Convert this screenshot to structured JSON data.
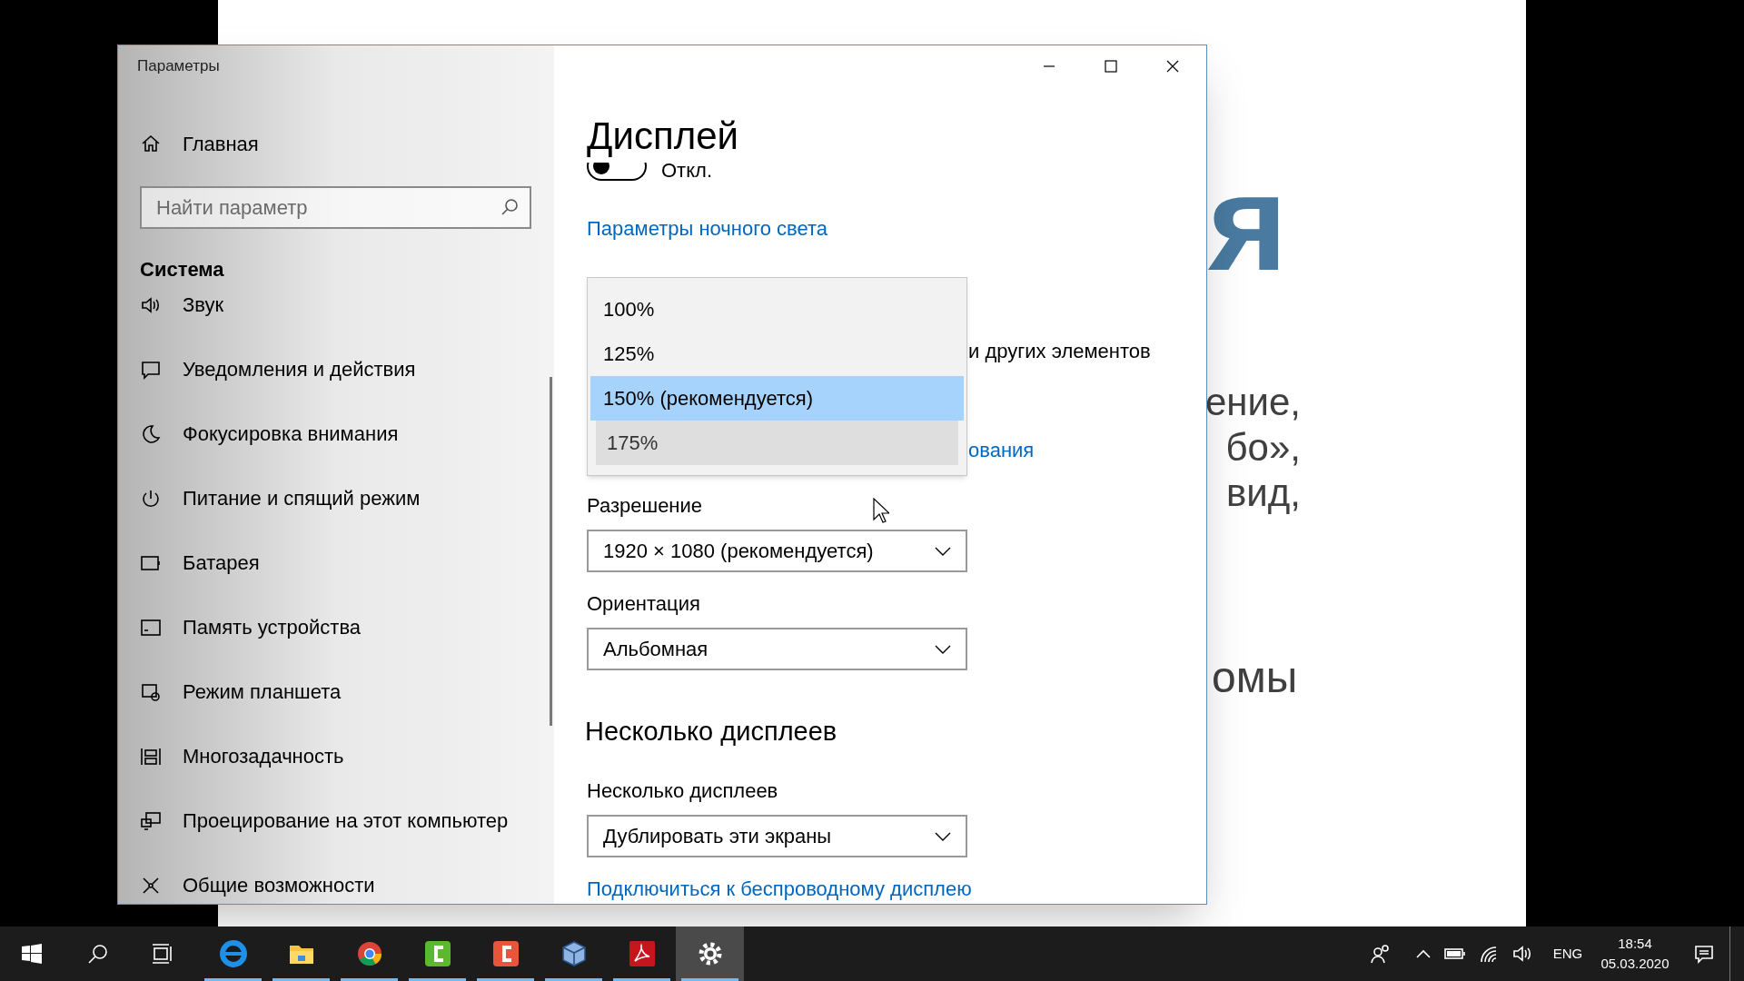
{
  "window": {
    "title": "Параметры"
  },
  "sidebar": {
    "home": "Главная",
    "search": {
      "placeholder": "Найти параметр"
    },
    "section": "Система",
    "items": [
      {
        "label": "Звук",
        "kind": "sound"
      },
      {
        "label": "Уведомления и действия",
        "kind": "notifications"
      },
      {
        "label": "Фокусировка внимания",
        "kind": "focus"
      },
      {
        "label": "Питание и спящий режим",
        "kind": "power"
      },
      {
        "label": "Батарея",
        "kind": "battery"
      },
      {
        "label": "Память устройства",
        "kind": "storage"
      },
      {
        "label": "Режим планшета",
        "kind": "tablet"
      },
      {
        "label": "Многозадачность",
        "kind": "multitasking"
      },
      {
        "label": "Проецирование на этот компьютер",
        "kind": "projecting"
      },
      {
        "label": "Общие возможности",
        "kind": "shared"
      }
    ]
  },
  "content": {
    "title": "Дисплей",
    "toggle": {
      "on": false,
      "label": "Откл."
    },
    "night_light_link": "Параметры ночного света",
    "scale_text_fragment": "и других элементов",
    "scale_link_fragment": "ования",
    "scale_dropdown": {
      "options": [
        {
          "label": "100%",
          "selected": false,
          "hovered": false
        },
        {
          "label": "125%",
          "selected": false,
          "hovered": false
        },
        {
          "label": "150% (рекомендуется)",
          "selected": true,
          "hovered": false
        },
        {
          "label": "175%",
          "selected": false,
          "hovered": true
        }
      ]
    },
    "resolution": {
      "label": "Разрешение",
      "value": "1920 × 1080 (рекомендуется)"
    },
    "orientation": {
      "label": "Ориентация",
      "value": "Альбомная"
    },
    "multiple_displays": {
      "heading": "Несколько дисплеев",
      "label": "Несколько дисплеев",
      "value": "Дублировать эти экраны"
    },
    "wireless_link": "Подключиться к беспроводному дисплею"
  },
  "background_slide": {
    "title_fragment": "я",
    "lines": [
      "ение,",
      "бо»,",
      "вид,"
    ],
    "line_fragment": "омы"
  },
  "taskbar": {
    "apps": [
      {
        "kind": "browser",
        "running": true,
        "selected": false
      },
      {
        "kind": "folder",
        "running": true,
        "selected": false
      },
      {
        "kind": "chrome",
        "running": true,
        "selected": false
      },
      {
        "kind": "recorder",
        "running": true,
        "selected": false
      },
      {
        "kind": "editor",
        "running": true,
        "selected": false
      },
      {
        "kind": "cube",
        "running": true,
        "selected": false
      },
      {
        "kind": "pdf",
        "running": true,
        "selected": false
      },
      {
        "kind": "settings",
        "running": true,
        "selected": true
      }
    ],
    "language": "ENG",
    "time": "18:54",
    "date": "05.03.2020"
  }
}
